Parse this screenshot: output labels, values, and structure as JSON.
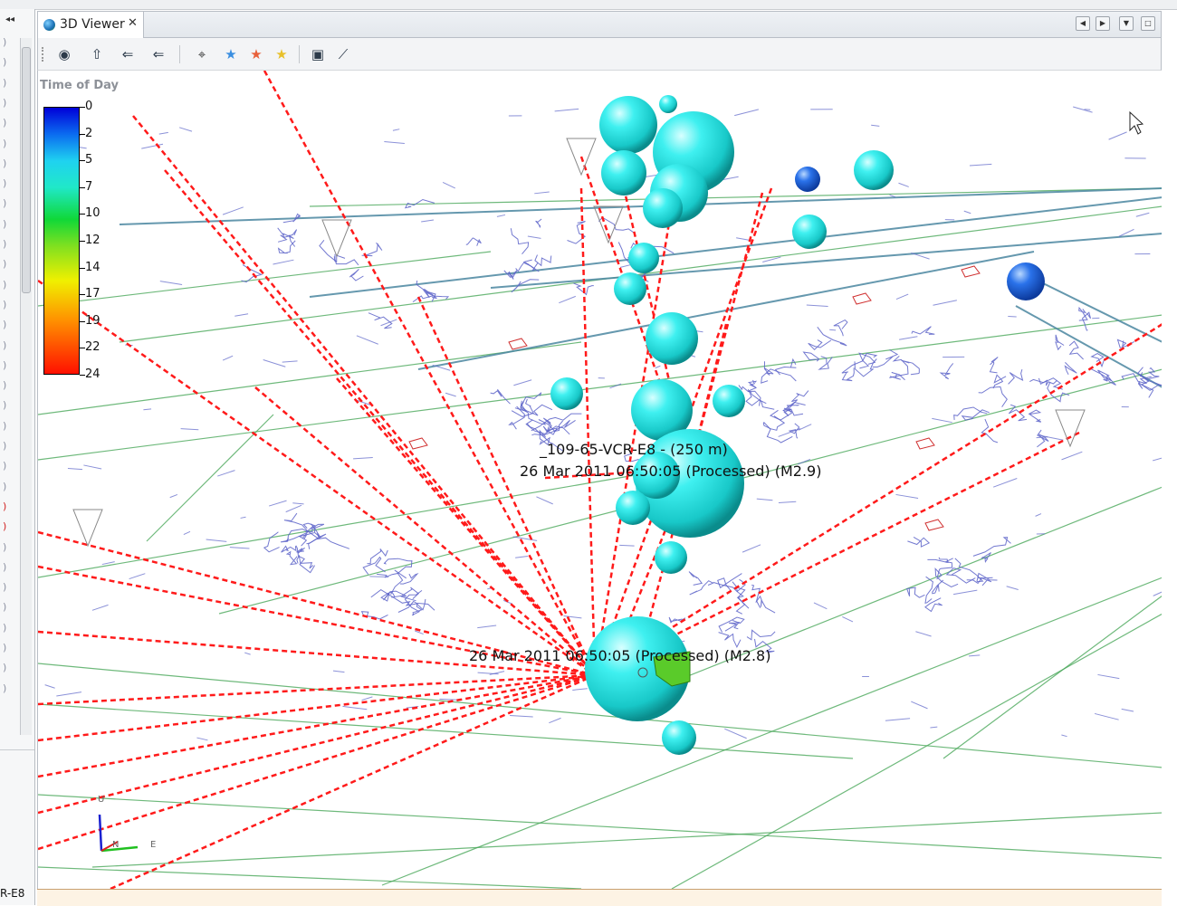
{
  "window": {
    "tab_title": "3D Viewer",
    "tab_close": "✕"
  },
  "left_panel": {
    "collapse_glyph": "◂◂",
    "items": [
      ")",
      ")",
      ")",
      ")",
      ")",
      ")",
      ")",
      ")",
      ")",
      ")",
      ")",
      ")",
      ")",
      ")",
      ")",
      ")",
      ")",
      ")",
      ")",
      ")",
      ")",
      ")",
      ")",
      ")",
      ")",
      ")",
      ")",
      ")",
      ")",
      ")",
      ")",
      ")",
      ")"
    ],
    "bottom_label": "R-E8"
  },
  "toolbar": {
    "buttons": [
      "eye-icon",
      "pin-icon",
      "north-view-icon",
      "east-view-icon",
      "target-icon",
      "blue-star-icon",
      "red-star-icon",
      "yellow-star-icon",
      "camera-icon",
      "chart-icon"
    ]
  },
  "legend": {
    "title": "Time of Day",
    "ticks": [
      "0",
      "2",
      "5",
      "7",
      "10",
      "12",
      "14",
      "17",
      "19",
      "22",
      "24"
    ]
  },
  "scene": {
    "labels": {
      "upper_line1": "_109-65-VCR-E8 - (250 m)",
      "upper_line2": "26 Mar 2011 06:50:05 (Processed) (M2.9)",
      "lower_line1": "26 Mar 2011 06:50:05 (Processed) (M2.8)"
    },
    "axis": {
      "up": "U",
      "east": "E",
      "north": "N"
    },
    "colors": {
      "cyan_event": "#2ee6e6",
      "blue_event": "#1e64e0",
      "ray": "#ff1a1a",
      "tunnels_blue": "#5a62c8",
      "tunnels_green": "#4aa85a",
      "tunnels_teal": "#4a86a0"
    }
  }
}
